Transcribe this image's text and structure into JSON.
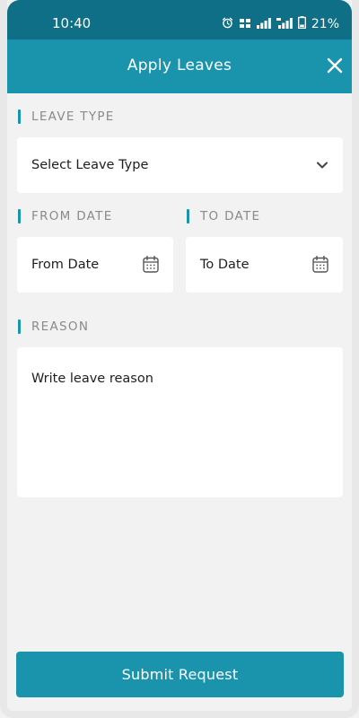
{
  "status_bar": {
    "time": "10:40",
    "battery": "21%",
    "icons": [
      "alarm-icon",
      "volte-icon",
      "signal-icon",
      "5g-signal-icon",
      "battery-icon"
    ]
  },
  "header": {
    "title": "Apply Leaves",
    "close_icon": "close-icon"
  },
  "form": {
    "leave_type": {
      "label": "LEAVE TYPE",
      "selected_value": "Select Leave Type",
      "icon": "chevron-down-icon"
    },
    "from_date": {
      "label": "FROM DATE",
      "placeholder": "From Date",
      "icon": "calendar-icon"
    },
    "to_date": {
      "label": "TO DATE",
      "placeholder": "To Date",
      "icon": "calendar-icon"
    },
    "reason": {
      "label": "REASON",
      "placeholder": "Write leave reason"
    }
  },
  "actions": {
    "submit_label": "Submit Request"
  },
  "colors": {
    "primary": "#1a93ad",
    "status_bar": "#0f6f86",
    "background": "#f2f2f2",
    "label": "#8a8a8a"
  }
}
